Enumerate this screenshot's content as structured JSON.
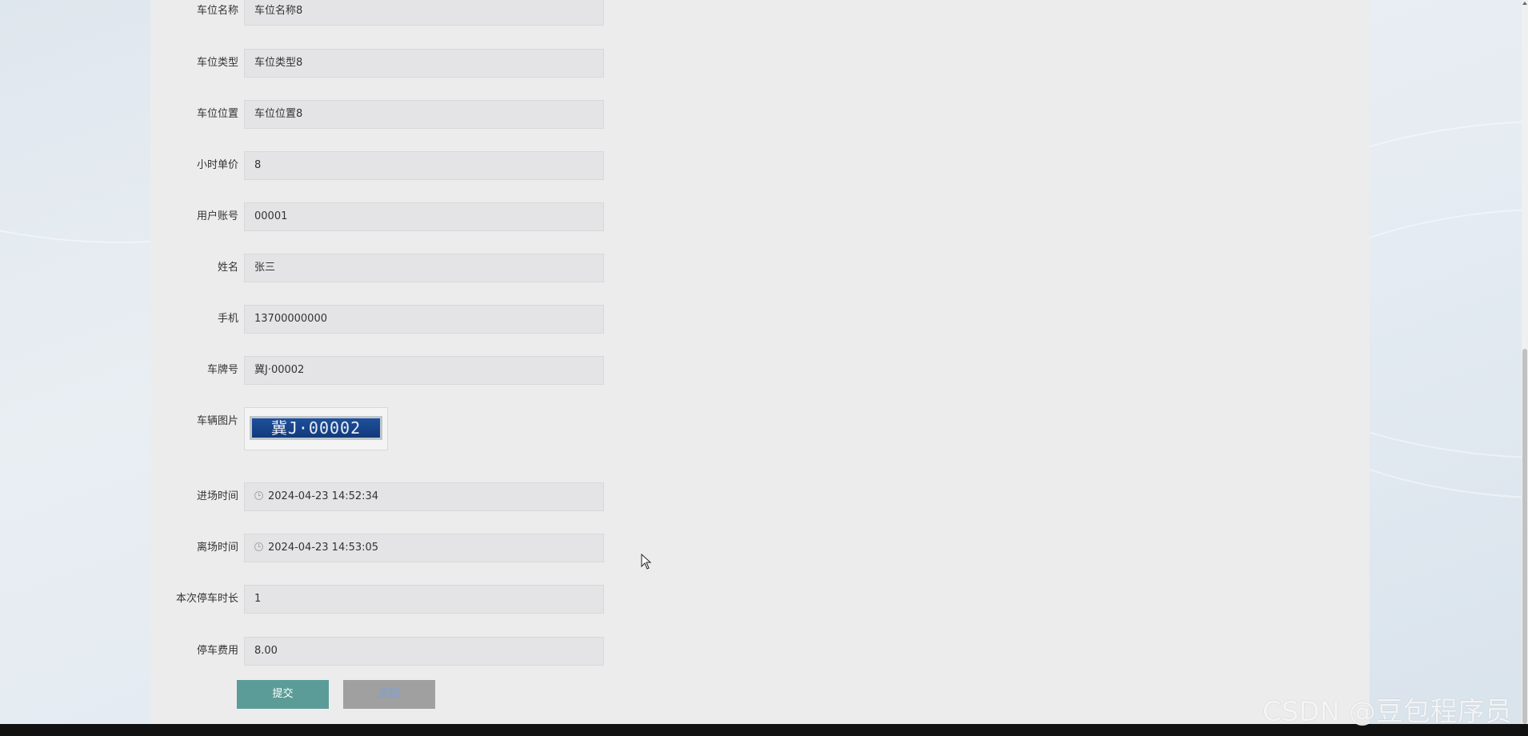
{
  "form": {
    "fields": [
      {
        "label": "车位名称",
        "value": "车位名称8"
      },
      {
        "label": "车位类型",
        "value": "车位类型8"
      },
      {
        "label": "车位位置",
        "value": "车位位置8"
      },
      {
        "label": "小时单价",
        "value": "8"
      },
      {
        "label": "用户账号",
        "value": "00001"
      },
      {
        "label": "姓名",
        "value": "张三"
      },
      {
        "label": "手机",
        "value": "13700000000"
      },
      {
        "label": "车牌号",
        "value": "冀J·00002"
      }
    ],
    "image_field": {
      "label": "车辆图片",
      "plate_text": "冀J·00002"
    },
    "time_fields": [
      {
        "label": "进场时间",
        "value": "2024-04-23 14:52:34",
        "icon": "clock-icon"
      },
      {
        "label": "离场时间",
        "value": "2024-04-23 14:53:05",
        "icon": "clock-icon"
      }
    ],
    "tail_fields": [
      {
        "label": "本次停车时长",
        "value": "1"
      },
      {
        "label": "停车费用",
        "value": "8.00"
      }
    ]
  },
  "buttons": {
    "submit": "提交",
    "reset": "返回"
  },
  "colors": {
    "submit_bg": "#5b9c98",
    "reset_bg": "#a0a0a0",
    "input_bg": "#e4e4e6",
    "panel_bg": "#ececec"
  },
  "watermark": "CSDN @豆包程序员"
}
